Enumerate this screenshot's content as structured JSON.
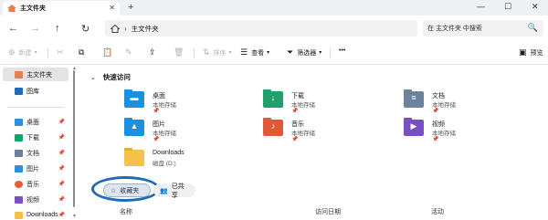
{
  "tab": {
    "title": "主文件夹",
    "close": "✕"
  },
  "newtab": "+",
  "window": {
    "minimize": "—",
    "maximize": "☐",
    "close": "✕"
  },
  "nav": {
    "back": "←",
    "forward": "→",
    "up": "↑",
    "refresh": "↻"
  },
  "address": {
    "separator": "›",
    "label": "主文件夹",
    "home_icon": "home-icon"
  },
  "search": {
    "placeholder": "在 主文件夹 中搜索",
    "icon": "🔍"
  },
  "toolbar": {
    "new": "新建",
    "sort": "排序",
    "view": "查看",
    "filter": "筛选器",
    "more": "•••",
    "preview": "预览"
  },
  "sidebar": {
    "items": [
      {
        "label": "主文件夹",
        "icon": "home-icon",
        "color": "#e67e52"
      },
      {
        "label": "图库",
        "icon": "gallery-icon",
        "color": "#1f6bb5"
      },
      {
        "label": "桌面",
        "icon": "desktop-icon",
        "color": "#2f8fd8"
      },
      {
        "label": "下载",
        "icon": "download-icon",
        "color": "#19a36b"
      },
      {
        "label": "文档",
        "icon": "documents-icon",
        "color": "#6d7f99"
      },
      {
        "label": "图片",
        "icon": "pictures-icon",
        "color": "#2f8fd8"
      },
      {
        "label": "音乐",
        "icon": "music-icon",
        "color": "#e65b3b"
      },
      {
        "label": "视频",
        "icon": "video-icon",
        "color": "#7a4fc2"
      },
      {
        "label": "Downloads",
        "icon": "folder-icon",
        "color": "#f3c24c"
      }
    ],
    "pin": "📌"
  },
  "quick_access": {
    "title": "快速访问",
    "items": [
      {
        "name": "桌面",
        "sub": "本地存储",
        "color": "#1b8fe0",
        "glyph": "▬"
      },
      {
        "name": "下载",
        "sub": "本地存储",
        "color": "#1fa06d",
        "glyph": "↓"
      },
      {
        "name": "文档",
        "sub": "本地存储",
        "color": "#6e819d",
        "glyph": "≡"
      },
      {
        "name": "图片",
        "sub": "本地存储",
        "color": "#1b8fe0",
        "glyph": "▲"
      },
      {
        "name": "音乐",
        "sub": "本地存储",
        "color": "#e0583a",
        "glyph": "♪"
      },
      {
        "name": "视频",
        "sub": "本地存储",
        "color": "#7a4fc2",
        "glyph": "▶"
      },
      {
        "name": "Downloads",
        "sub": "磁盘 (D:)",
        "color": "#f3c24c",
        "glyph": ""
      }
    ],
    "pin": "📌"
  },
  "bottom_tabs": {
    "favorites": "收藏夹",
    "shared": "已共享"
  },
  "columns": {
    "name": "名称",
    "date": "访问日期",
    "activity": "活动"
  }
}
